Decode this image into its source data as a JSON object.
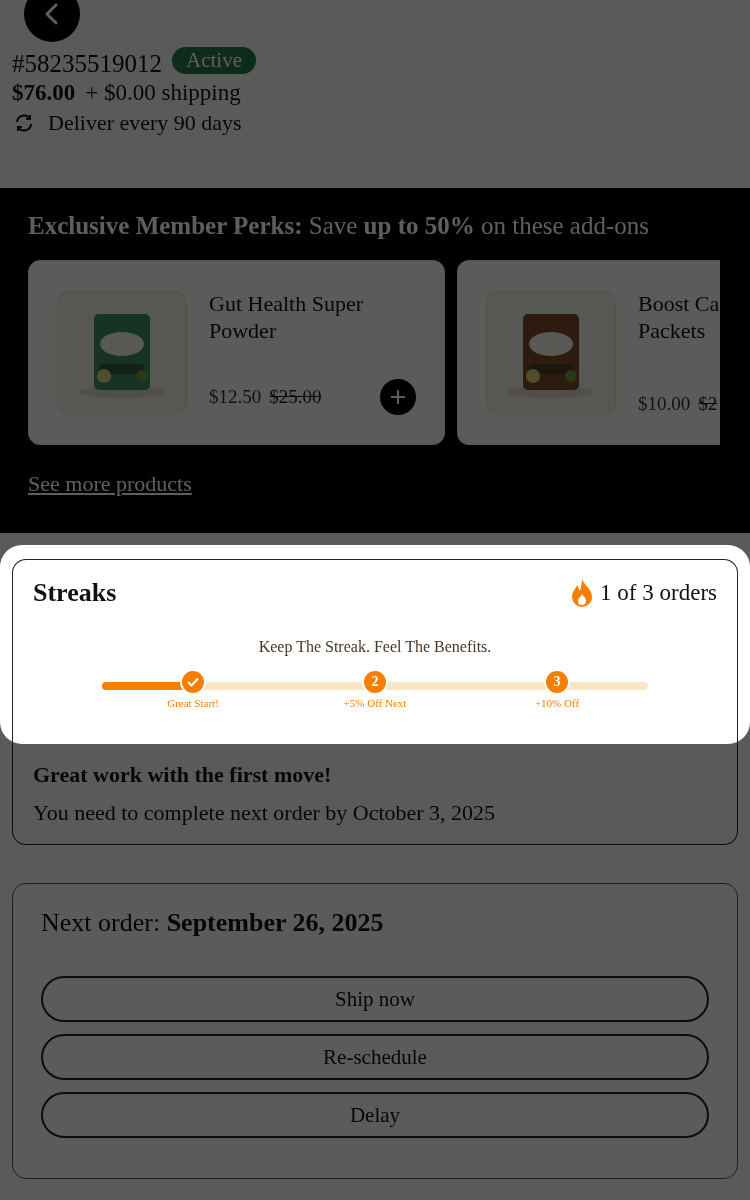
{
  "order": {
    "number": "#58235519012",
    "status": "Active",
    "price": "$76.00",
    "shipping": "+ $0.00 shipping",
    "frequency": "Deliver every 90 days"
  },
  "perks": {
    "title": "**Exclusive Member Perks:** Save **up to 50%** on these add-ons",
    "products": [
      {
        "name": "Gut Health Super Powder",
        "price": "$12.50",
        "original_price": "$25.00"
      },
      {
        "name": "Boost Ca\nPackets",
        "price": "$10.00",
        "original_price": "$2"
      }
    ],
    "link": "See more products"
  },
  "streaks": {
    "title": "Streaks",
    "count": "1 of 3 orders",
    "tagline": "Keep The Streak. Feel The Benefits.",
    "level": 0.17,
    "steps": [
      {
        "label": "Great Start!",
        "completed": true
      },
      {
        "number": "2",
        "label": "+5% Off Next",
        "completed": false
      },
      {
        "number": "3",
        "label": "+10% Off",
        "completed": false
      }
    ],
    "message_title": "Great work with the first move!",
    "message": "You need to complete next order by October 3, 2025"
  },
  "next_order": {
    "label": "Next order:",
    "date": "September 26, 2025",
    "buttons": [
      "Ship now",
      "Re-schedule",
      "Delay"
    ]
  }
}
